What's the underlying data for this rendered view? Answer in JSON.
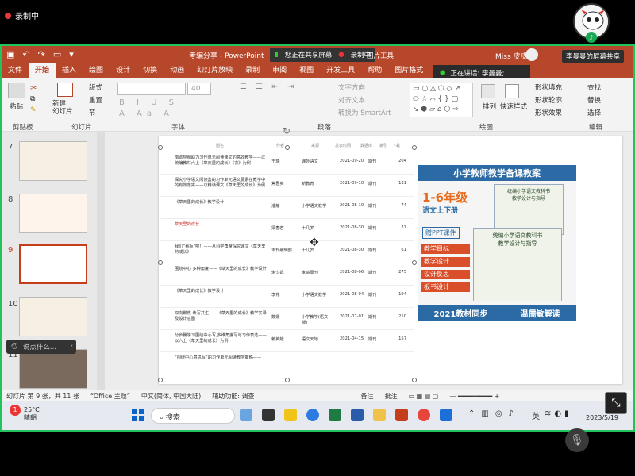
{
  "recording": {
    "label": "录制中"
  },
  "window": {
    "title": "考编分享 - PowerPoint",
    "share_banner": "您正在共享屏幕",
    "share_recording": "录制中",
    "picture_tools": "图片工具",
    "user": "Miss 皮皮",
    "sharing_tag": "李曼曼的屏幕共享",
    "speaking": "正在讲话: 李曼曼;"
  },
  "tabs": [
    "文件",
    "开始",
    "插入",
    "绘图",
    "设计",
    "切换",
    "动画",
    "幻灯片放映",
    "录制",
    "审阅",
    "视图",
    "开发工具",
    "帮助",
    "图片格式",
    "操作"
  ],
  "ribbon": {
    "groups": [
      "剪贴板",
      "幻灯片",
      "字体",
      "段落",
      "绘图",
      "编辑"
    ],
    "paste": "粘贴",
    "new_slide": "新建\n幻灯片",
    "layout": "版式",
    "reset": "重置",
    "section": "节",
    "font_size": "40",
    "text_direction": "文字方向",
    "align_text": "对齐文本",
    "smartart": "转换为 SmartArt",
    "arrange": "排列",
    "quick_styles": "快速样式",
    "shape_fill": "形状填充",
    "shape_outline": "形状轮廓",
    "shape_effects": "形状效果",
    "find": "查找",
    "replace": "替换",
    "select": "选择"
  },
  "thumbnails": [
    "7",
    "8",
    "9",
    "10",
    "11"
  ],
  "table": {
    "header": [
      "题名",
      "作者",
      "来源",
      "发表时间",
      "数据库",
      "被引",
      "下载"
    ],
    "rows": [
      {
        "title": "借助导图助力习作单元阅读课文的高效教学——以统编教材六上《草天里的成长》《衣》为例",
        "author": "王瑞",
        "source": "课外语文",
        "date": "2021-09-20",
        "db": "期刊",
        "dl": "204"
      },
      {
        "title": "探究小学语文阅读鉴的习作单元语文要素在教学中的有效落实——以精读课文《草天里的成长》为例",
        "author": "焦惠英",
        "source": "新教育",
        "date": "2021-09-10",
        "db": "期刊",
        "dl": "131"
      },
      {
        "title": "《草天里的成长》教学设计",
        "author": "潘静",
        "source": "小学语文教学",
        "date": "2021-08-10",
        "db": "期刊",
        "dl": "74"
      },
      {
        "title": "草天里的成长",
        "author": "梁春若",
        "source": "十几岁",
        "date": "2021-08-30",
        "db": "期刊",
        "dl": "27"
      },
      {
        "title": "我们“看板”吧！——从科学角度探究课文《草天里的成长》",
        "author": "本刊编辑部",
        "source": "十几岁",
        "date": "2021-08-30",
        "db": "期刊",
        "dl": "61"
      },
      {
        "title": "围绕中心 多种角度——《草天里的成长》教学设计",
        "author": "朱少妃",
        "source": "家庭周刊",
        "date": "2021-08-06",
        "db": "期刊",
        "dl": "275"
      },
      {
        "title": "《草天里的成长》教学设计",
        "author": "李花",
        "source": "小学语文教学",
        "date": "2021-08-04",
        "db": "期刊",
        "dl": "194"
      },
      {
        "title": "双向聚焦 读写共生——《草天里的成长》教学实录及设计意图",
        "author": "魏娜",
        "source": "小学教学(语文版)",
        "date": "2021-07-01",
        "db": "期刊",
        "dl": "210"
      },
      {
        "title": "分步騰学习围绕中心写,多维角度写与习作表达——以六上《草天里的成长》为例",
        "author": "赖英娥",
        "source": "语文天地",
        "date": "2021-04-15",
        "db": "期刊",
        "dl": "157"
      },
      {
        "title": "“围绕中心意思写”的习作单元阅读教学策略——",
        "author": "",
        "source": "",
        "date": "",
        "db": "",
        "dl": ""
      }
    ]
  },
  "ad": {
    "head": "小学教师教学备课教案",
    "grade": "1-6年级",
    "sub": "语文上下册",
    "ppt": "赠PPT课件",
    "tags": [
      "教学目标",
      "教学设计",
      "设计反思",
      "板书设计"
    ],
    "book1": "统编小学语文教科书\n教学设计与指导",
    "book2": "统编小学语文教科书\n教学设计与指导",
    "bottom_left": "2021教材同步",
    "bottom_right": "温儒敏解读"
  },
  "status": {
    "slide": "幻灯片 第 9 张，共 11 张",
    "theme": "“Office 主题”",
    "lang": "中文(简体, 中国大陆)",
    "access": "辅助功能: 调查",
    "notes": "备注",
    "comments": "批注"
  },
  "chat": {
    "placeholder": "说点什么..."
  },
  "taskbar": {
    "temp": "25°C",
    "weather": "晴朗",
    "search": "搜索",
    "ime": "英",
    "time": "20:",
    "date": "2023/5/19",
    "badge": "1"
  }
}
